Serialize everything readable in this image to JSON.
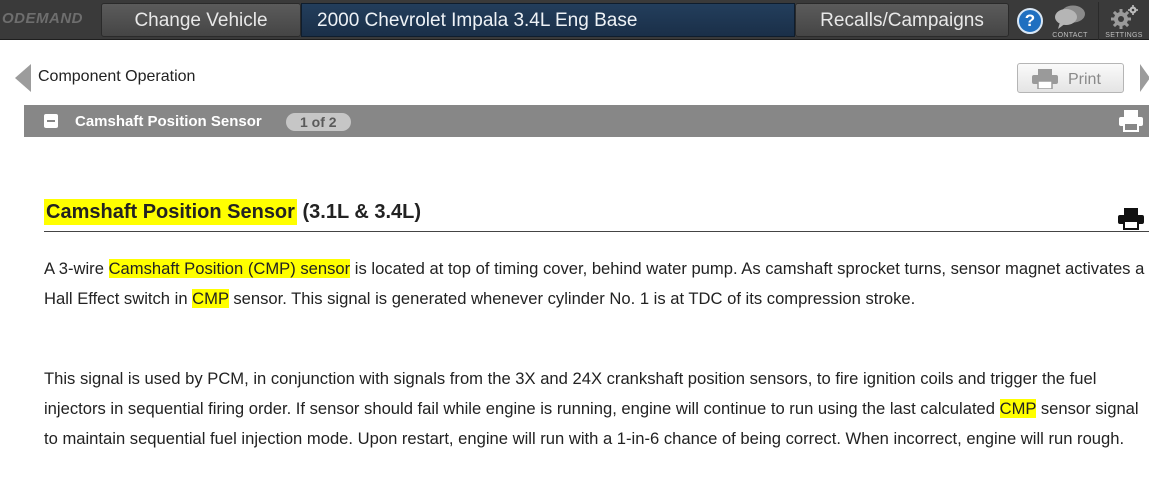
{
  "topbar": {
    "logo_text": "ODEMAND",
    "change_vehicle_label": "Change Vehicle",
    "vehicle_title": "2000 Chevrolet Impala 3.4L Eng Base",
    "recalls_label": "Recalls/Campaigns",
    "help_label": "?",
    "contact_label": "CONTACT",
    "settings_label": "SETTINGS"
  },
  "subheader": {
    "breadcrumb": "Component Operation",
    "print_label": "Print"
  },
  "section": {
    "title": "Camshaft Position Sensor",
    "page_indicator": "1 of 2"
  },
  "article": {
    "heading_highlight": "Camshaft Position Sensor",
    "heading_rest": " (3.1L & 3.4L)",
    "para1": {
      "t1": "A 3-wire ",
      "h1": "Camshaft Position (CMP) sensor",
      "t2": " is located at top of timing cover, behind water pump. As camshaft sprocket turns, sensor magnet activates a Hall Effect switch in ",
      "h2": "CMP",
      "t3": " sensor. This signal is generated whenever cylinder No. 1 is at TDC of its compression stroke."
    },
    "para2": {
      "t1": "This signal is used by PCM, in conjunction with signals from the 3X and 24X crankshaft position sensors, to fire ignition coils and trigger the fuel injectors in sequential firing order. If sensor should fail while engine is running, engine will continue to run using the last calculated ",
      "h1": "CMP",
      "t2": " sensor signal to maintain sequential fuel injection mode. Upon restart, engine will run with a 1-in-6 chance of being correct. When incorrect, engine will run rough."
    }
  },
  "colors": {
    "highlight": "#ffff00",
    "topbar_bg": "#3a3a3a",
    "vehicle_bg": "#1a2f48",
    "section_bar_bg": "#878787",
    "help_blue": "#1f6fc0"
  },
  "icons": {
    "back": "left-triangle-arrow",
    "forward": "right-triangle-arrow",
    "print": "printer-icon",
    "contact": "chat-bubbles-icon",
    "settings": "gears-icon",
    "collapse": "minus-square-icon"
  }
}
